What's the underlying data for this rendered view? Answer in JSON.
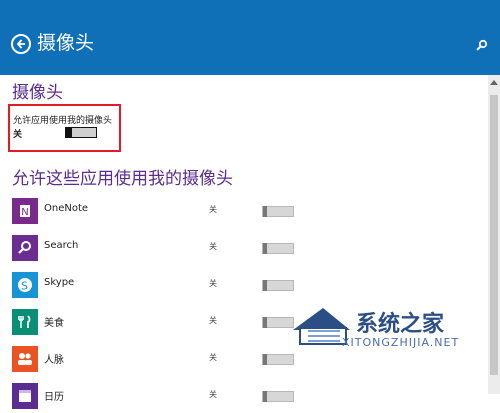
{
  "header": {
    "title": "摄像头",
    "back_icon": "back-icon",
    "search_icon": "search-icon",
    "background_color": "#0f6fb7"
  },
  "sections": {
    "camera_title": "摄像头",
    "allow_apps_title": "允许这些应用使用我的摄像头"
  },
  "main_setting": {
    "label": "允许应用使用我的摄像头",
    "state": "关"
  },
  "apps": [
    {
      "name": "OneNote",
      "state": "关",
      "icon": "onenote-icon",
      "color": "#7a2a8a"
    },
    {
      "name": "Search",
      "state": "关",
      "icon": "search-app-icon",
      "color": "#6b2d8f"
    },
    {
      "name": "Skype",
      "state": "关",
      "icon": "skype-icon",
      "color": "#1893d5"
    },
    {
      "name": "美食",
      "state": "关",
      "icon": "food-icon",
      "color": "#0a8f77"
    },
    {
      "name": "人脉",
      "state": "关",
      "icon": "people-icon",
      "color": "#e95422"
    },
    {
      "name": "日历",
      "state": "关",
      "icon": "calendar-icon",
      "color": "#5b2d90"
    }
  ],
  "watermark": {
    "text": "系统之家",
    "subtext": "XITONGZHIJIA.NET"
  },
  "accent_color": "#5b2d90",
  "highlight_color": "#e21c24"
}
